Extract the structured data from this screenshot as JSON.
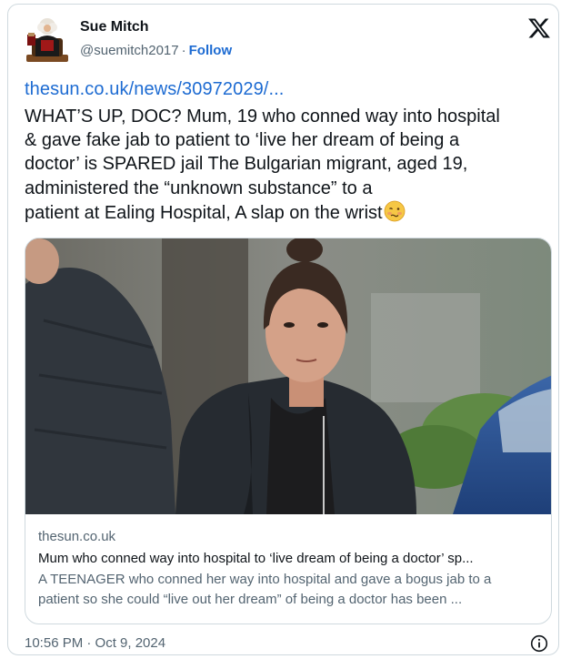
{
  "author": {
    "name": "Sue Mitch",
    "handle": "@suemitch2017",
    "separator": "·",
    "follow_label": "Follow"
  },
  "tweet": {
    "link_text": "thesun.co.uk/news/30972029/...",
    "text_lines": [
      "WHAT’S UP, DOC? Mum, 19 who conned way into hospital",
      "& gave fake jab to patient to ‘live her dream of being a",
      "doctor’ is SPARED jail The Bulgarian migrant, aged 19,",
      "administered the “unknown substance” to a",
      "patient at Ealing Hospital, A slap on the wrist"
    ],
    "emoji": "woozy-face-emoji"
  },
  "link_card": {
    "domain": "thesun.co.uk",
    "title": "Mum who conned way into hospital to ‘live dream of being a doctor’ sp...",
    "description_lines": [
      "A TEENAGER who conned her way into hospital and gave a bogus jab to a",
      "patient so she could “live out her dream” of being a doctor has been ..."
    ]
  },
  "timestamp": "10:56 PM · Oct 9, 2024",
  "icons": {
    "brand": "x-logo-icon",
    "info": "info-icon"
  },
  "colors": {
    "link": "#1d6bd2",
    "secondary_text": "#536471",
    "border": "#cfd9de"
  }
}
